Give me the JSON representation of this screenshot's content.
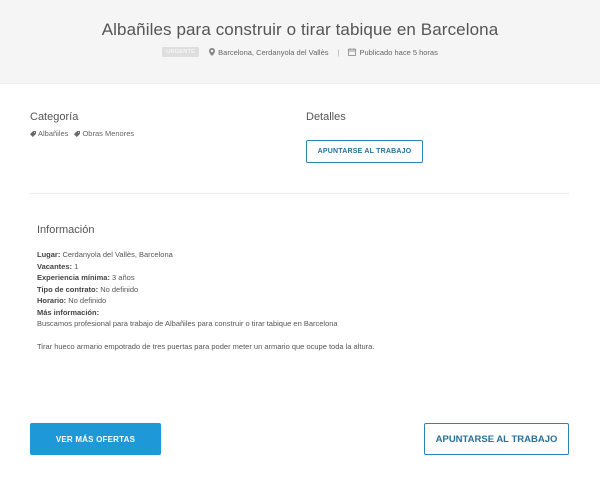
{
  "header": {
    "title": "Albañiles para construir o tirar tabique en Barcelona",
    "badge": "urgente",
    "location": "Barcelona, Cerdanyola del Vallès",
    "separator": "|",
    "published": "Publicado hace 5 horas"
  },
  "categoria": {
    "title": "Categoría",
    "tags": [
      "Albañiles",
      "Obras Menores"
    ]
  },
  "detalles": {
    "title": "Detalles",
    "apply_label": "Apuntarse al trabajo"
  },
  "informacion": {
    "title": "Información",
    "lugar_label": "Lugar:",
    "lugar_value": "Cerdanyola del Vallès, Barcelona",
    "vacantes_label": "Vacantes:",
    "vacantes_value": "1",
    "experiencia_label": "Experiencia mínima:",
    "experiencia_value": "3 años",
    "contrato_label": "Tipo de contrato:",
    "contrato_value": "No definido",
    "horario_label": "Horario:",
    "horario_value": "No definido",
    "mas_label": "Más información:",
    "description_1": "Buscamos profesional para trabajo de Albañiles para construir o tirar tabique en Barcelona",
    "description_2": "Tirar hueco armario empotrado de tres puertas para poder meter un armario que ocupe toda la altura."
  },
  "footer": {
    "more_offers_label": "Ver más ofertas",
    "apply_label": "Apuntarse al trabajo"
  },
  "colors": {
    "primary": "#1e98d7",
    "outline": "#2a85b5",
    "header_bg": "#f5f5f5"
  }
}
